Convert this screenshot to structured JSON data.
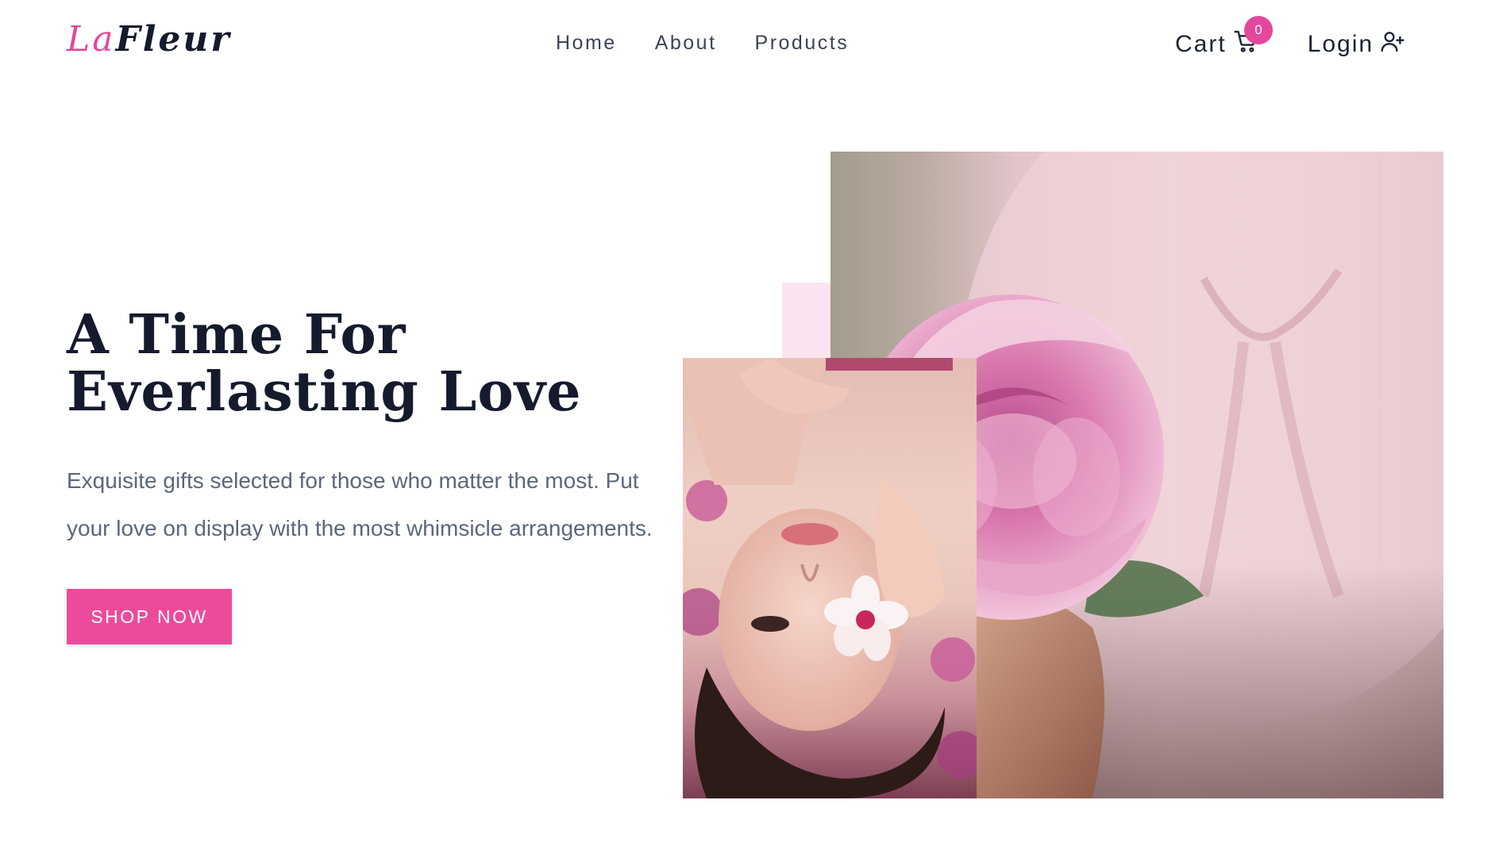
{
  "brand": {
    "logo_part1": "La",
    "logo_part2": "Fleur",
    "accent_color": "#ec4b9c"
  },
  "nav": {
    "items": [
      {
        "label": "Home"
      },
      {
        "label": "About"
      },
      {
        "label": "Products"
      }
    ]
  },
  "actions": {
    "cart": {
      "label": "Cart",
      "icon": "cart-icon",
      "count": "0"
    },
    "login": {
      "label": "Login",
      "icon": "user-plus-icon"
    }
  },
  "hero": {
    "title_line1": "A Time For",
    "title_line2": "Everlasting Love",
    "description": "Exquisite gifts selected for those who matter the most. Put your love on display with the most whimsicle arrangements.",
    "cta_label": "SHOP NOW"
  },
  "colors": {
    "heading": "#151b2c",
    "body_text": "#5c6779",
    "accent_block": "#fbe4f0",
    "badge": "#e4479b"
  }
}
